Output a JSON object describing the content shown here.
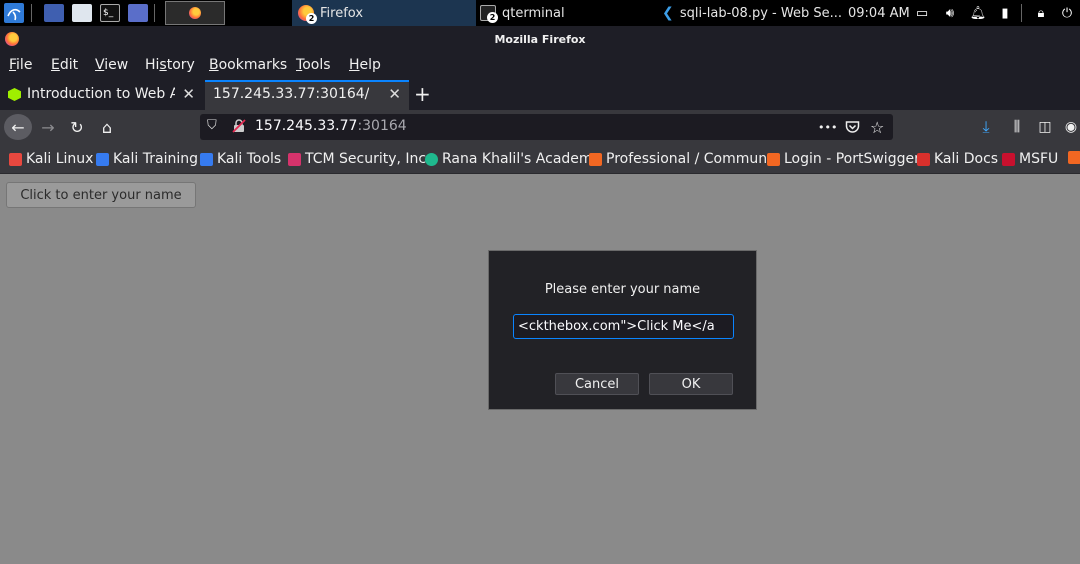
{
  "taskbar": {
    "tasks": [
      {
        "label": "Firefox",
        "badge": "2"
      },
      {
        "label": "qterminal",
        "badge": "2"
      },
      {
        "label": "sqli-lab-08.py - Web Se..."
      }
    ],
    "clock": "09:04 AM"
  },
  "window": {
    "title": "Mozilla Firefox"
  },
  "menu": {
    "file": {
      "u": "F",
      "rest": "ile"
    },
    "edit": {
      "u": "E",
      "rest": "dit"
    },
    "view": {
      "u": "V",
      "rest": "iew"
    },
    "history": {
      "pre": "Hi",
      "u": "s",
      "rest": "tory"
    },
    "bookmarks": {
      "u": "B",
      "rest": "ookmarks"
    },
    "tools": {
      "u": "T",
      "rest": "ools"
    },
    "help": {
      "u": "H",
      "rest": "elp"
    }
  },
  "tabs": [
    {
      "label": "Introduction to Web Applic",
      "close": "✕"
    },
    {
      "label": "157.245.33.77:30164/",
      "close": "✕"
    }
  ],
  "newtab": "+",
  "nav": {
    "url_host": "157.245.33.77",
    "url_port": ":30164",
    "more": "•••"
  },
  "bookmarks": [
    {
      "label": "Kali Linux",
      "color": "#e8483f"
    },
    {
      "label": "Kali Training",
      "color": "#367bf0"
    },
    {
      "label": "Kali Tools",
      "color": "#367bf0"
    },
    {
      "label": "TCM Security, Inc.",
      "color": "#d6336c"
    },
    {
      "label": "Rana Khalil's Academy",
      "color": "#1fb98e"
    },
    {
      "label": "Professional / Commun...",
      "color": "#f26722"
    },
    {
      "label": "Login - PortSwigger",
      "color": "#f26722"
    },
    {
      "label": "Kali Docs",
      "color": "#d9302c"
    },
    {
      "label": "MSFU",
      "color": "#c8102e"
    }
  ],
  "page": {
    "button_label": "Click to enter your name"
  },
  "dialog": {
    "message": "Please enter your name",
    "input_value": "ckthebox.com\">Click Me</a>",
    "cancel": "Cancel",
    "ok": "OK"
  }
}
